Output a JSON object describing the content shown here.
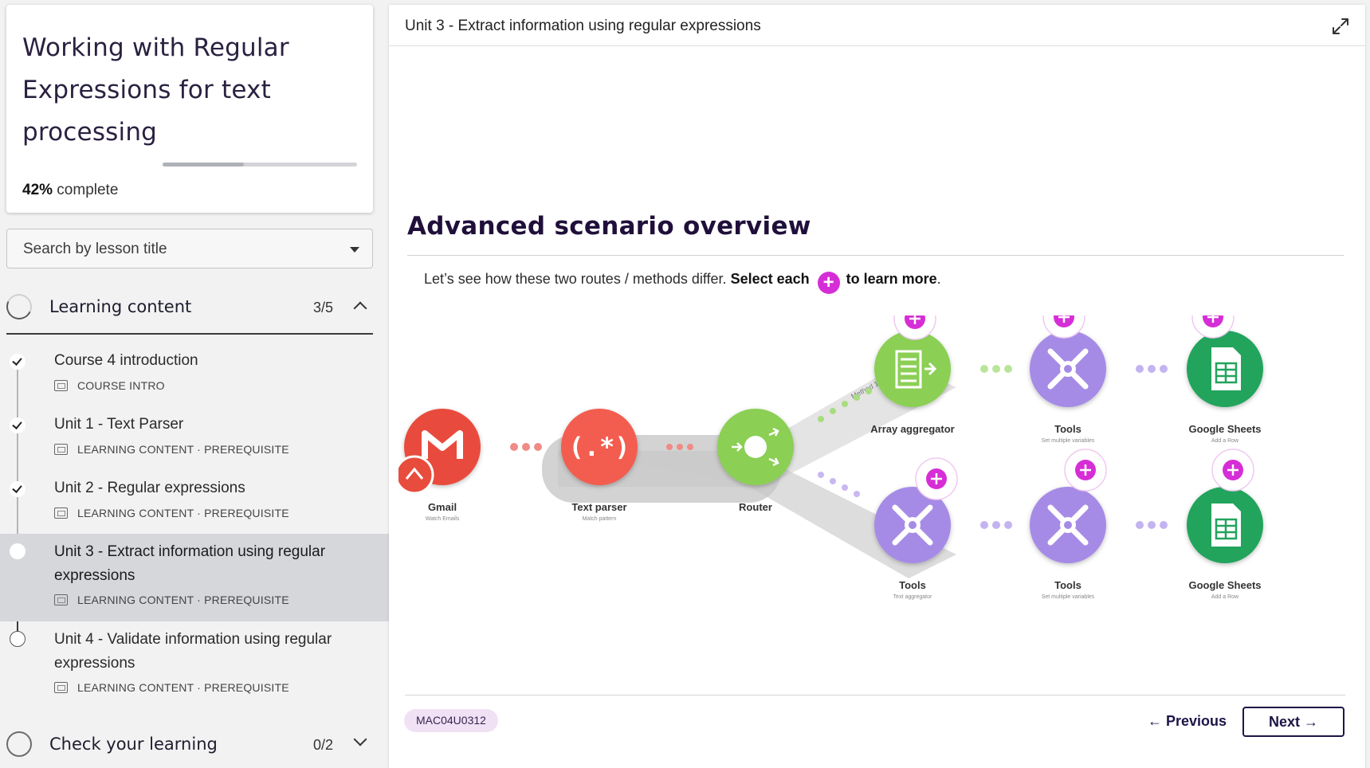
{
  "course": {
    "title": "Working with Regular Expressions for text processing",
    "progress_percent": 42,
    "progress_value": "42%",
    "progress_suffix": " complete"
  },
  "search": {
    "placeholder": "Search by lesson title"
  },
  "sections": [
    {
      "title": "Learning content",
      "count": "3/5",
      "expanded": true,
      "lessons": [
        {
          "name": "Course 4 introduction",
          "meta": "COURSE INTRO",
          "status": "done"
        },
        {
          "name": "Unit 1 - Text Parser",
          "meta": "LEARNING CONTENT · PREREQUISITE",
          "status": "done"
        },
        {
          "name": "Unit 2 - Regular expressions",
          "meta": "LEARNING CONTENT · PREREQUISITE",
          "status": "done"
        },
        {
          "name": "Unit 3 - Extract information using regular expressions",
          "meta": "LEARNING CONTENT · PREREQUISITE",
          "status": "current"
        },
        {
          "name": "Unit 4 - Validate information using regular expressions",
          "meta": "LEARNING CONTENT · PREREQUISITE",
          "status": "open"
        }
      ]
    },
    {
      "title": "Check your learning",
      "count": "0/2",
      "expanded": false
    }
  ],
  "main": {
    "unit_title": "Unit 3 - Extract information using regular expressions",
    "overview_title": "Advanced scenario overview",
    "instruction_prefix": "Let’s see how these two routes / methods differ. ",
    "instruction_bold_1": "Select each",
    "instruction_bold_2": "to learn more",
    "instruction_end": ".",
    "code_tag": "MAC04U0312",
    "previous_label": "Previous",
    "next_label": "Next"
  },
  "diagram": {
    "route_label": "Method 1",
    "nodes": [
      {
        "name": "Gmail",
        "sub": "Watch Emails",
        "color": "#e84c3d"
      },
      {
        "name": "Text parser",
        "sub": "Match pattern",
        "color": "#f35d4f"
      },
      {
        "name": "Router",
        "sub": "",
        "color": "#8bcf55"
      },
      {
        "name": "Array aggregator",
        "sub": "",
        "color": "#8bcf55"
      },
      {
        "name": "Tools",
        "sub": "Set multiple variables",
        "color": "#a68be6"
      },
      {
        "name": "Google Sheets",
        "sub": "Add a Row",
        "color": "#22a45d"
      },
      {
        "name": "Tools",
        "sub": "Text aggregator",
        "color": "#a68be6"
      },
      {
        "name": "Tools",
        "sub": "Set multiple variables",
        "color": "#a68be6"
      },
      {
        "name": "Google Sheets",
        "sub": "Add a Row",
        "color": "#22a45d"
      }
    ],
    "accent_plus": "#d62ed6"
  }
}
